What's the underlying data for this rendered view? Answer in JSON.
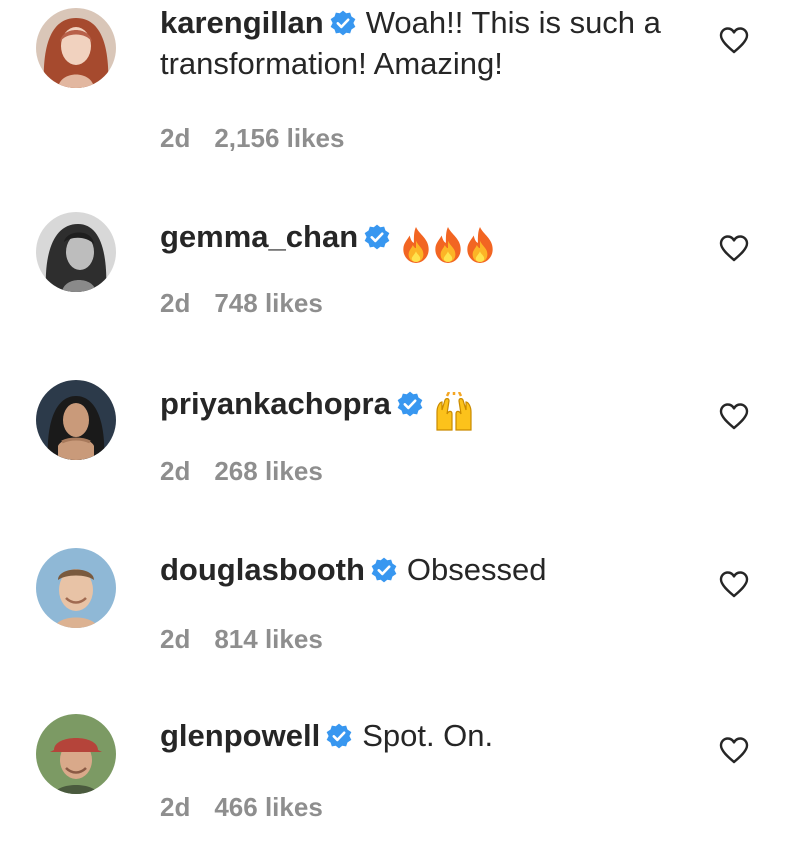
{
  "comments": [
    {
      "username": "karengillan",
      "text": "Woah!! This is such a transformation! Amazing!",
      "time": "2d",
      "likes": "2,156 likes",
      "avatar_color": "#b8614a"
    },
    {
      "username": "gemma_chan",
      "text": "",
      "emoji": "fire-emoji-x3",
      "time": "2d",
      "likes": "748 likes",
      "avatar_color": "#6b6b6b"
    },
    {
      "username": "priyankachopra",
      "text": "",
      "emoji": "raising-hands-emoji",
      "time": "2d",
      "likes": "268 likes",
      "avatar_color": "#3a4a5c"
    },
    {
      "username": "douglasbooth",
      "text": "Obsessed",
      "time": "2d",
      "likes": "814 likes",
      "avatar_color": "#7fa6c4"
    },
    {
      "username": "glenpowell",
      "text": "Spot. On.",
      "time": "2d",
      "likes": "466 likes",
      "avatar_color": "#6e8f5e"
    }
  ],
  "colors": {
    "verified": "#3897f0",
    "meta_text": "#8e8e8e",
    "body_text": "#262626"
  },
  "icons": {
    "verified": "verified-badge-icon",
    "like": "heart-outline-icon"
  }
}
